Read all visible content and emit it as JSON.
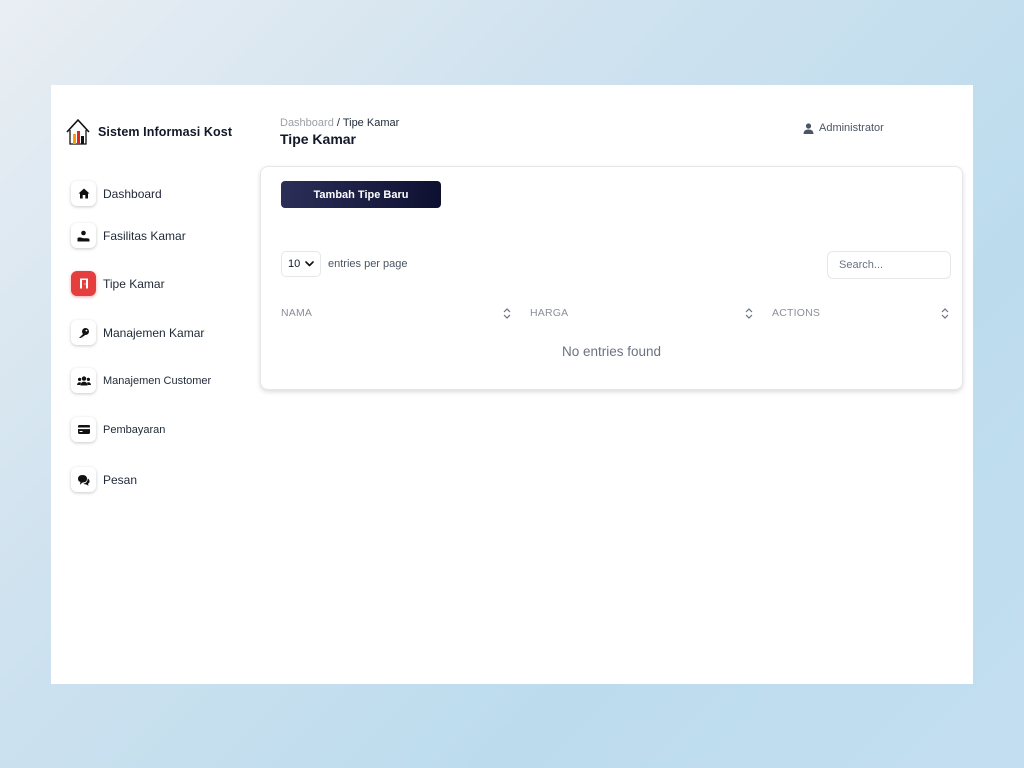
{
  "sidebar": {
    "brand": "Sistem Informasi Kost",
    "items": [
      {
        "label": "Dashboard",
        "icon": "home-icon"
      },
      {
        "label": "Fasilitas Kamar",
        "icon": "hand-holding-icon"
      },
      {
        "label": "Tipe Kamar",
        "icon": "door-icon",
        "active": true
      },
      {
        "label": "Manajemen Kamar",
        "icon": "key-icon"
      },
      {
        "label": "Manajemen Customer",
        "icon": "users-icon"
      },
      {
        "label": "Pembayaran",
        "icon": "credit-card-icon"
      },
      {
        "label": "Pesan",
        "icon": "chat-bubbles-icon"
      }
    ]
  },
  "header": {
    "breadcrumb_parent": "Dashboard",
    "breadcrumb_separator": " / ",
    "breadcrumb_current": "Tipe Kamar",
    "title": "Tipe Kamar",
    "user": "Administrator"
  },
  "card": {
    "add_button": "Tambah Tipe Baru",
    "per_page_value": "10",
    "per_page_label": "entries per page",
    "search_placeholder": "Search...",
    "columns": [
      "NAMA",
      "HARGA",
      "ACTIONS"
    ],
    "empty_message": "No entries found"
  },
  "colors": {
    "accent_active": "#e53e3e",
    "button_start": "#2b2f58",
    "button_end": "#0d1030"
  }
}
